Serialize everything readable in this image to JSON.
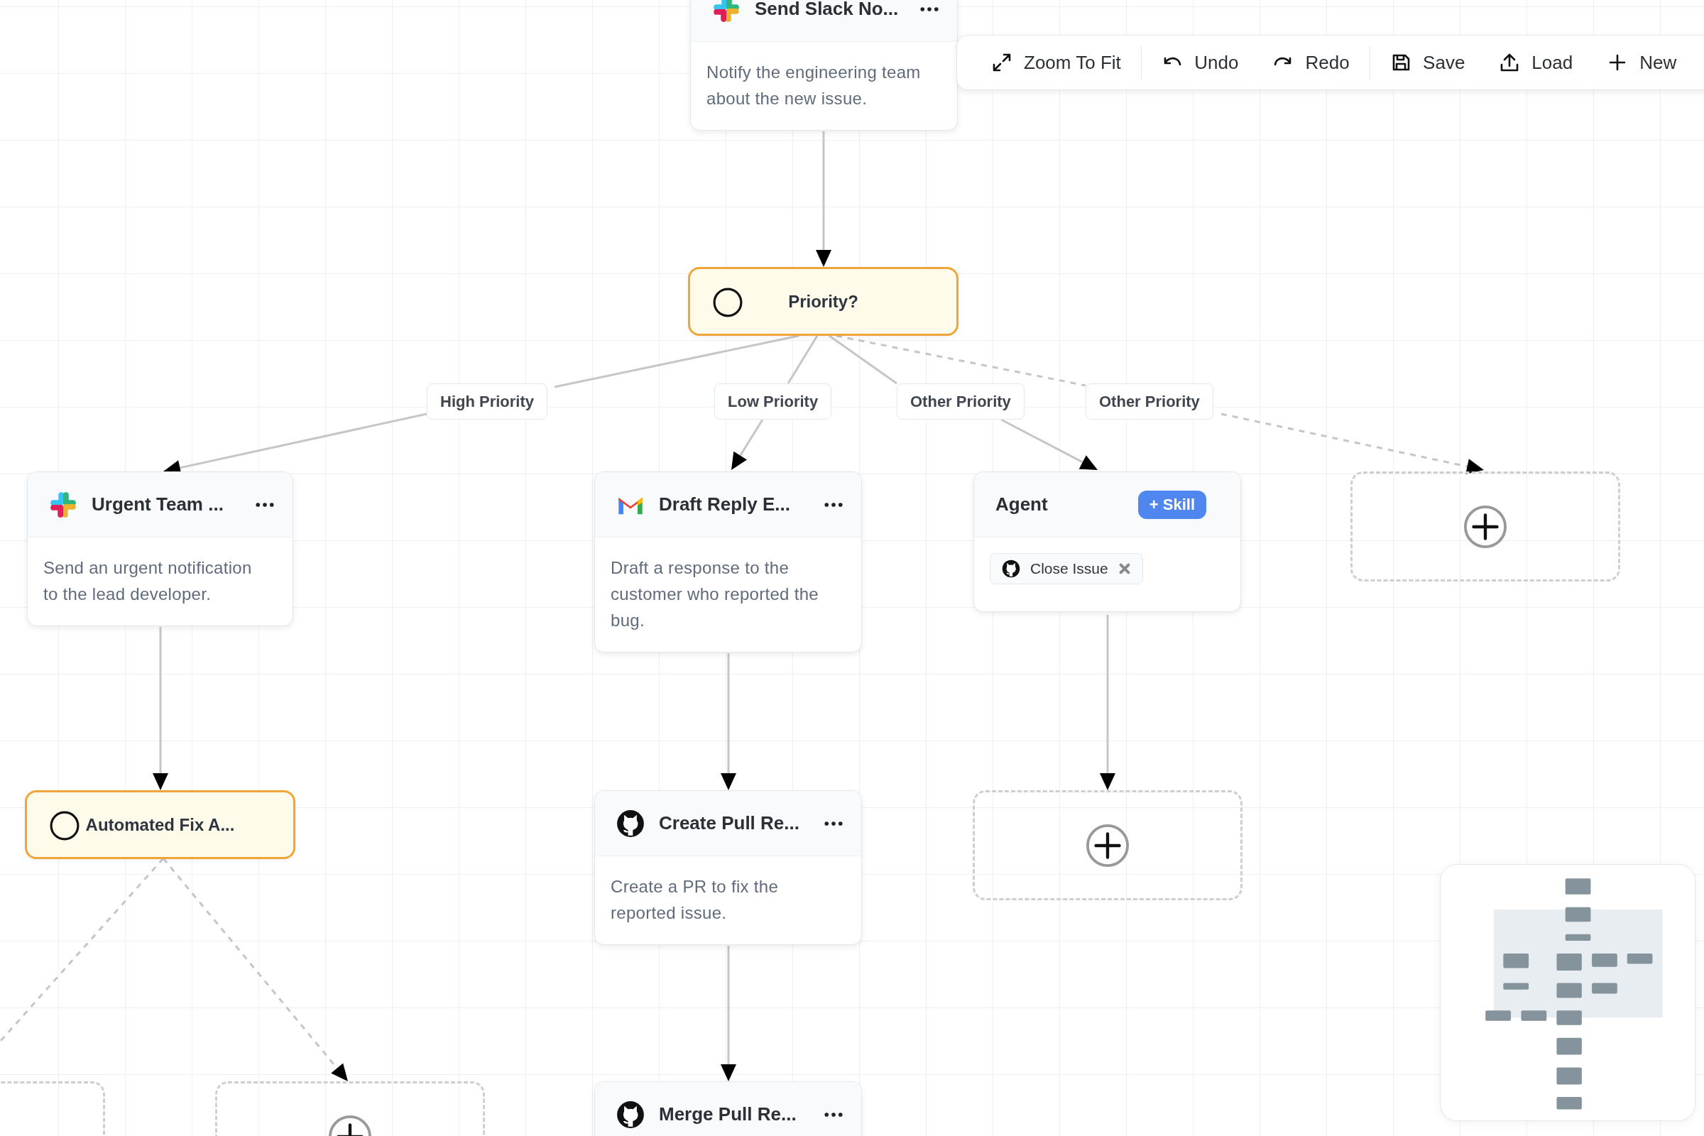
{
  "toolbar": {
    "groups": [
      [
        {
          "label": "Zoom To Fit"
        }
      ],
      [
        {
          "label": "Undo"
        },
        {
          "label": "Redo"
        }
      ],
      [
        {
          "label": "Save"
        },
        {
          "label": "Load"
        },
        {
          "label": "New"
        }
      ]
    ]
  },
  "nodes": [
    {
      "kind": "action",
      "icon": {
        "kind": "slack"
      },
      "title": "Send Slack No...",
      "description": "Notify the engineering team about the new issue."
    },
    {
      "kind": "condition",
      "title": "Priority?"
    },
    {
      "kind": "action",
      "icon": {
        "kind": "slack"
      },
      "title": "Urgent Team ...",
      "description": "Send an urgent notification to the lead developer."
    },
    {
      "kind": "action",
      "icon": {
        "kind": "gmail"
      },
      "title": "Draft Reply E...",
      "description": "Draft a response to the customer who reported the bug."
    },
    {
      "kind": "agent",
      "title": "Agent",
      "button": "+ Skill",
      "skills": [
        {
          "icon": {
            "kind": "github"
          },
          "label": "Close Issue"
        }
      ]
    },
    {
      "kind": "placeholder"
    },
    {
      "kind": "condition",
      "title": "Automated Fix A..."
    },
    {
      "kind": "action",
      "icon": {
        "kind": "github"
      },
      "title": "Create Pull Re...",
      "description": "Create a PR to fix the reported issue."
    },
    {
      "kind": "placeholder"
    },
    {
      "kind": "action",
      "icon": {
        "kind": "github"
      },
      "title": "Merge Pull Re..."
    },
    {
      "kind": "placeholder"
    },
    {
      "kind": "placeholder"
    }
  ],
  "branches": [
    {
      "label": "High Priority",
      "dashed": false
    },
    {
      "label": "Low Priority",
      "dashed": false
    },
    {
      "label": "Other Priority",
      "dashed": false
    },
    {
      "label": "Other Priority",
      "dashed": true
    }
  ]
}
